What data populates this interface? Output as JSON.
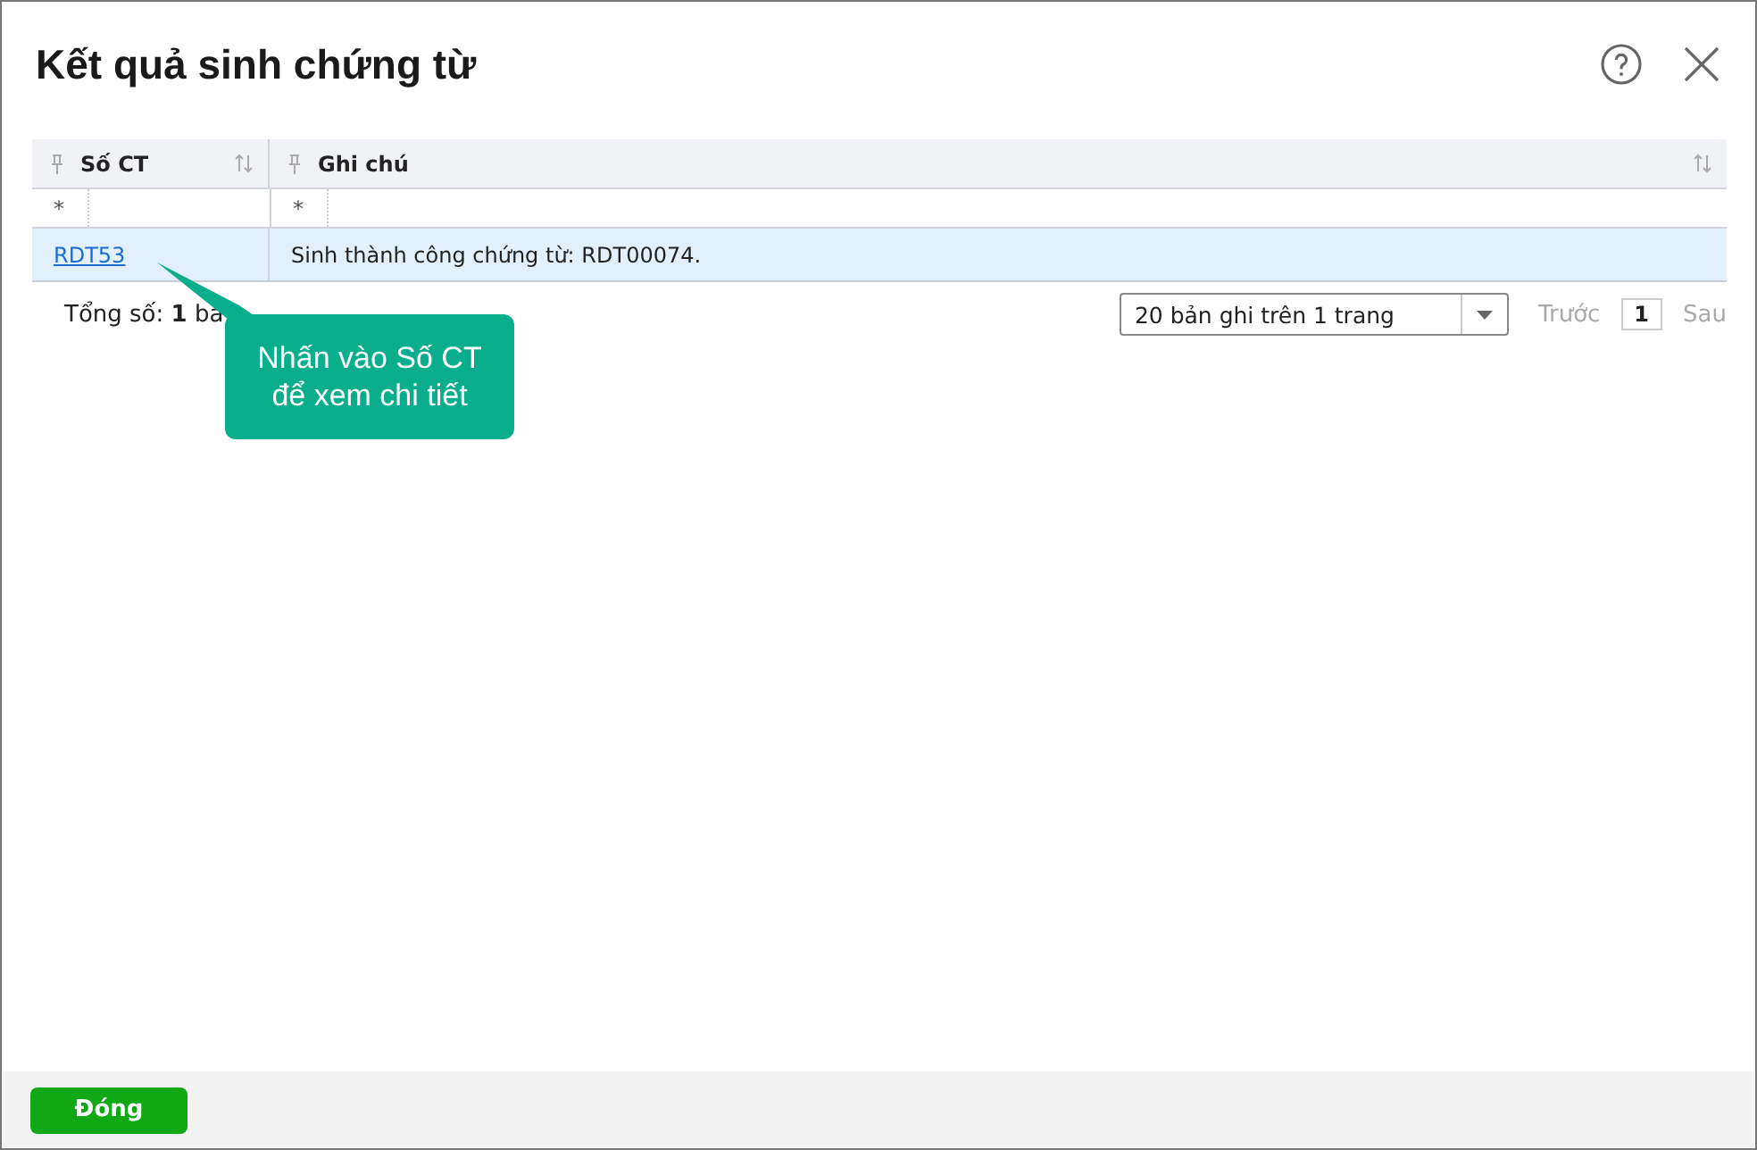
{
  "window": {
    "title": "Kết quả sinh chứng từ"
  },
  "table": {
    "columns": [
      {
        "label": "Số CT",
        "filter": "*",
        "sortable": true
      },
      {
        "label": "Ghi chú",
        "filter": "*",
        "sortable": true
      }
    ],
    "rows": [
      {
        "selected": true,
        "cells": [
          {
            "kind": "link",
            "text": "RDT53"
          },
          {
            "kind": "text",
            "text": "Sinh thành công chứng từ: RDT00074."
          }
        ]
      }
    ]
  },
  "pager": {
    "total": "Tổng số: **1** ba",
    "page_size": "20 bản ghi trên 1 trang",
    "prev": "Trước",
    "page": "1",
    "next": "Sau"
  },
  "tooltip": {
    "lines": [
      "Nhấn vào Số CT",
      "để xem chi tiết"
    ]
  },
  "footer": {
    "close_button": "Đóng"
  }
}
